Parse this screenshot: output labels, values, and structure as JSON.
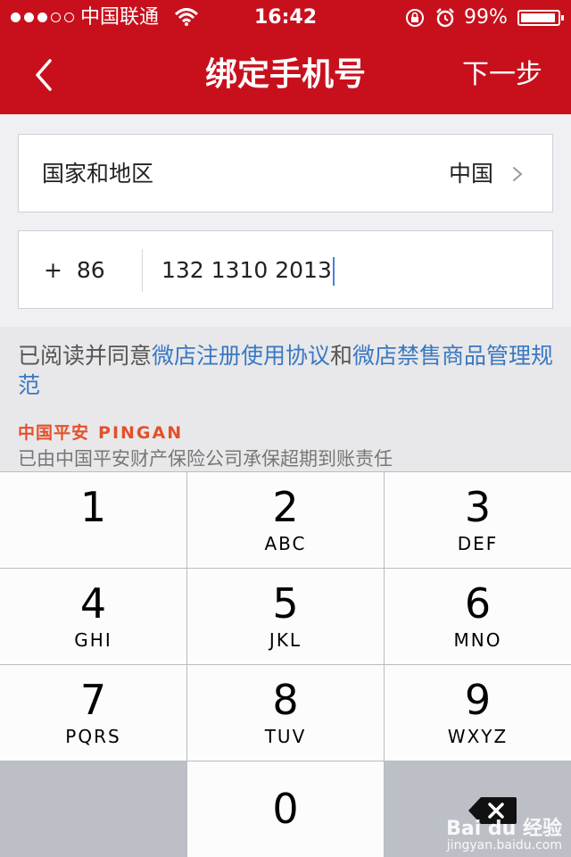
{
  "status_bar": {
    "carrier": "中国联通",
    "time": "16:42",
    "battery": "99%"
  },
  "nav": {
    "title": "绑定手机号",
    "next": "下一步",
    "back_icon": "chevron-left-icon"
  },
  "form": {
    "country_label": "国家和地区",
    "country_value": "中国",
    "phone_code": "+  86",
    "phone_number": "132 1310 2013"
  },
  "agreement": {
    "prefix": "已阅读并同意",
    "link1": "微店注册使用协议",
    "conjunction": "和",
    "link2": "微店禁售商品管理规范"
  },
  "insurance": {
    "brand_cn": "中国平安",
    "brand_en": "PINGAN",
    "text": "已由中国平安财产保险公司承保超期到账责任"
  },
  "keypad": {
    "keys": [
      {
        "num": "1",
        "letters": ""
      },
      {
        "num": "2",
        "letters": "ABC"
      },
      {
        "num": "3",
        "letters": "DEF"
      },
      {
        "num": "4",
        "letters": "GHI"
      },
      {
        "num": "5",
        "letters": "JKL"
      },
      {
        "num": "6",
        "letters": "MNO"
      },
      {
        "num": "7",
        "letters": "PQRS"
      },
      {
        "num": "8",
        "letters": "TUV"
      },
      {
        "num": "9",
        "letters": "WXYZ"
      },
      {
        "num": "0",
        "letters": ""
      }
    ],
    "delete_icon": "backspace-icon"
  },
  "watermark": {
    "brand": "Bai du 经验",
    "url": "jingyan.baidu.com"
  }
}
